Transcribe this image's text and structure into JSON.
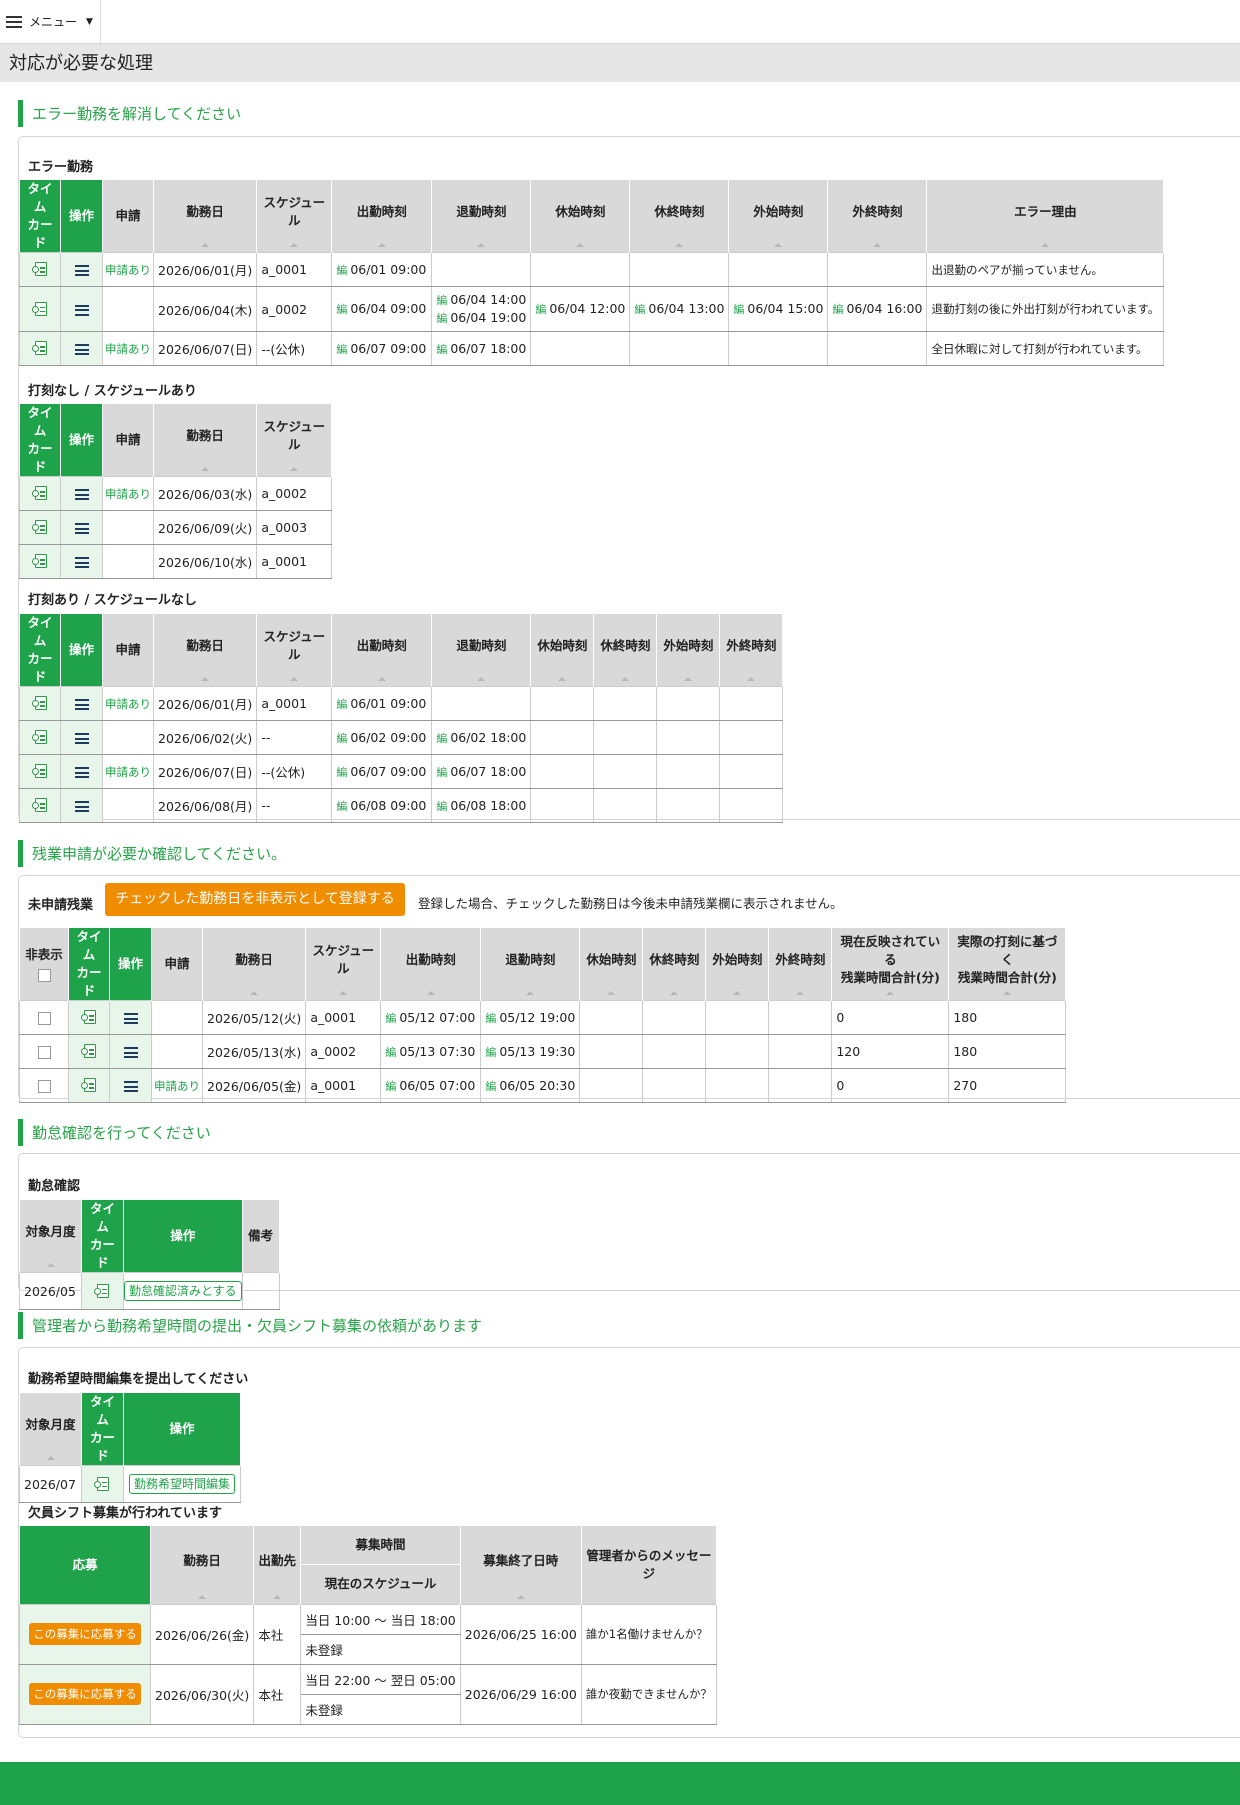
{
  "header": {
    "menu_label": "メニュー"
  },
  "page_title": "対応が必要な処理",
  "sections": {
    "error": "エラー勤務を解消してください",
    "overtime": "残業申請が必要か確認してください。",
    "attendance": "勤怠確認を行ってください",
    "manager": "管理者から勤務希望時間の提出・欠員シフト募集の依頼があります"
  },
  "col": {
    "timecard": "タイム\nカード",
    "op": "操作",
    "apply": "申請",
    "workday": "勤務日",
    "schedule": "スケジュール",
    "in": "出勤時刻",
    "out": "退勤時刻",
    "bs": "休始時刻",
    "be": "休終時刻",
    "os": "外始時刻",
    "oe": "外終時刻",
    "reason": "エラー理由",
    "hide": "非表示",
    "current_ot": "現在反映されている\n残業時間合計(分)",
    "actual_ot": "実際の打刻に基づく\n残業時間合計(分)",
    "month": "対象月度",
    "remarks": "備考",
    "respond": "応募",
    "dest": "出勤先",
    "recruit_time": "募集時間",
    "current_schedule": "現在のスケジュール",
    "recruit_end": "募集終了日時",
    "message": "管理者からのメッセージ"
  },
  "error_table": {
    "title": "エラー勤務",
    "rows": [
      {
        "apply": "申請あり",
        "day": "2026/06/01(月)",
        "sch": "a_0001",
        "in": [
          "06/01 09:00"
        ],
        "out": [],
        "bs": "",
        "be": "",
        "os": "",
        "oe": "",
        "reason": "出退勤のペアが揃っていません。"
      },
      {
        "apply": "",
        "day": "2026/06/04(木)",
        "sch": "a_0002",
        "in": [
          "06/04 09:00"
        ],
        "out": [
          "06/04 14:00",
          "06/04 19:00"
        ],
        "bs": "06/04 12:00",
        "be": "06/04 13:00",
        "os": "06/04 15:00",
        "oe": "06/04 16:00",
        "reason": "退勤打刻の後に外出打刻が行われています。"
      },
      {
        "apply": "申請あり",
        "day": "2026/06/07(日)",
        "sch": "--(公休)",
        "in": [
          "06/07 09:00"
        ],
        "out": [
          "06/07 18:00"
        ],
        "bs": "",
        "be": "",
        "os": "",
        "oe": "",
        "reason": "全日休暇に対して打刻が行われています。"
      }
    ]
  },
  "noclock_table": {
    "title": "打刻なし / スケジュールあり",
    "rows": [
      {
        "apply": "申請あり",
        "day": "2026/06/03(水)",
        "sch": "a_0002"
      },
      {
        "apply": "",
        "day": "2026/06/09(火)",
        "sch": "a_0003"
      },
      {
        "apply": "",
        "day": "2026/06/10(水)",
        "sch": "a_0001"
      }
    ]
  },
  "nosched_table": {
    "title": "打刻あり / スケジュールなし",
    "rows": [
      {
        "apply": "申請あり",
        "day": "2026/06/01(月)",
        "sch": "a_0001",
        "in": "06/01 09:00",
        "out": ""
      },
      {
        "apply": "",
        "day": "2026/06/02(火)",
        "sch": "--",
        "in": "06/02 09:00",
        "out": "06/02 18:00"
      },
      {
        "apply": "申請あり",
        "day": "2026/06/07(日)",
        "sch": "--(公休)",
        "in": "06/07 09:00",
        "out": "06/07 18:00"
      },
      {
        "apply": "",
        "day": "2026/06/08(月)",
        "sch": "--",
        "in": "06/08 09:00",
        "out": "06/08 18:00"
      }
    ]
  },
  "overtime": {
    "title": "未申請残業",
    "button": "チェックした勤務日を非表示として登録する",
    "note": "登録した場合、チェックした勤務日は今後未申請残業欄に表示されません。",
    "rows": [
      {
        "apply": "",
        "day": "2026/05/12(火)",
        "sch": "a_0001",
        "in": "05/12 07:00",
        "out": "05/12 19:00",
        "cur": "0",
        "act": "180"
      },
      {
        "apply": "",
        "day": "2026/05/13(水)",
        "sch": "a_0002",
        "in": "05/13 07:30",
        "out": "05/13 19:30",
        "cur": "120",
        "act": "180"
      },
      {
        "apply": "申請あり",
        "day": "2026/06/05(金)",
        "sch": "a_0001",
        "in": "06/05 07:00",
        "out": "06/05 20:30",
        "cur": "0",
        "act": "270"
      }
    ]
  },
  "attendance": {
    "title": "勤怠確認",
    "month": "2026/05",
    "button": "勤怠確認済みとする"
  },
  "wish": {
    "title": "勤務希望時間編集を提出してください",
    "month": "2026/07",
    "button": "勤務希望時間編集"
  },
  "recruit": {
    "title": "欠員シフト募集が行われています",
    "button": "この募集に応募する",
    "rows": [
      {
        "day": "2026/06/26(金)",
        "dest": "本社",
        "time": "当日 10:00 〜 当日 18:00",
        "cur": "未登録",
        "end": "2026/06/25 16:00",
        "msg": "誰か1名働けませんか？"
      },
      {
        "day": "2026/06/30(火)",
        "dest": "本社",
        "time": "当日 22:00 〜 翌日 05:00",
        "cur": "未登録",
        "end": "2026/06/29 16:00",
        "msg": "誰か夜勤できませんか？"
      }
    ]
  },
  "icons": [
    "menu-icon",
    "timecard-icon",
    "operation-icon",
    "sort-icon"
  ],
  "colors": {
    "accent": "#1ea24a",
    "orange": "#f08c00"
  }
}
